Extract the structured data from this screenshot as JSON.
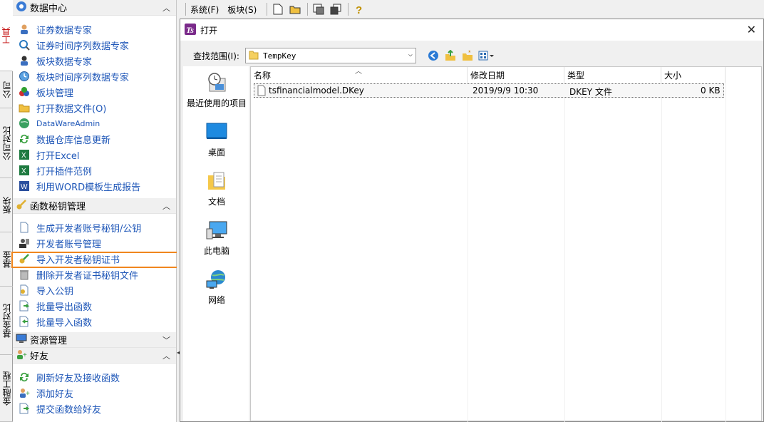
{
  "vertical_tabs": [
    "工具",
    "公司",
    "公司对比",
    "板块",
    "基金",
    "基金对比",
    "金融工程"
  ],
  "sidebar": {
    "section1": {
      "title": "数据中心",
      "items": [
        {
          "label": "证券数据专家",
          "icon": "user-icon"
        },
        {
          "label": "证券时间序列数据专家",
          "icon": "magnifier-icon"
        },
        {
          "label": "板块数据专家",
          "icon": "user-icon"
        },
        {
          "label": "板块时间序列数据专家",
          "icon": "clock-icon"
        },
        {
          "label": "板块管理",
          "icon": "balls-icon"
        },
        {
          "label": "打开数据文件(O)",
          "icon": "folder-icon"
        },
        {
          "label": "DataWareAdmin",
          "icon": "globe-icon"
        },
        {
          "label": "数据仓库信息更新",
          "icon": "refresh-icon"
        },
        {
          "label": "打开Excel",
          "icon": "excel-icon"
        },
        {
          "label": "打开插件范例",
          "icon": "excel-icon"
        },
        {
          "label": "利用WORD模板生成报告",
          "icon": "word-icon"
        }
      ]
    },
    "section2": {
      "title": "函数秘钥管理",
      "items": [
        {
          "label": "生成开发者账号秘钥/公钥",
          "icon": "document-icon"
        },
        {
          "label": "开发者账号管理",
          "icon": "account-icon"
        },
        {
          "label": "导入开发者秘钥证书",
          "icon": "key-icon"
        },
        {
          "label": "删除开发者证书秘钥文件",
          "icon": "trash-icon"
        },
        {
          "label": "导入公钥",
          "icon": "lock-doc-icon"
        },
        {
          "label": "批量导出函数",
          "icon": "export-icon"
        },
        {
          "label": "批量导入函数",
          "icon": "import-icon"
        }
      ]
    },
    "section3": {
      "title": "资源管理"
    },
    "section4": {
      "title": "好友",
      "items": [
        {
          "label": "刷新好友及接收函数",
          "icon": "refresh-icon"
        },
        {
          "label": "添加好友",
          "icon": "add-friend-icon"
        },
        {
          "label": "提交函数给好友",
          "icon": "export-icon"
        }
      ]
    }
  },
  "toolbar": {
    "menu_system": "系统(F)",
    "menu_block": "板块(S)"
  },
  "dialog": {
    "title": "打开",
    "lookin_label": "查找范围(I):",
    "lookin_value": "TempKey",
    "places": [
      "最近使用的项目",
      "桌面",
      "文档",
      "此电脑",
      "网络"
    ],
    "columns": [
      "名称",
      "修改日期",
      "类型",
      "大小"
    ],
    "files": [
      {
        "name": "tsfinancialmodel.DKey",
        "date": "2019/9/9 10:30",
        "type": "DKEY 文件",
        "size": "0 KB"
      }
    ]
  },
  "colors": {
    "link": "#1f57b8",
    "highlight": "#f0861e",
    "active_tab_text": "#c00000"
  }
}
